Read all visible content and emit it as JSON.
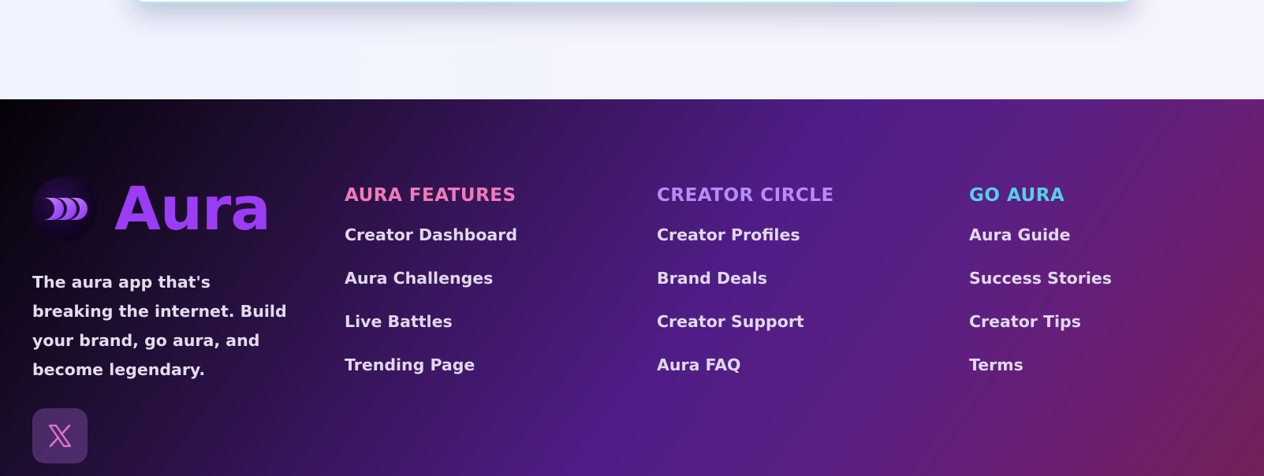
{
  "brand": {
    "name": "Aura",
    "tagline": "The aura app that's breaking the internet. Build your brand, go aura, and become legendary.",
    "accent_color": "#9a3df5",
    "logo_icon": "aura-logo-icon",
    "social": {
      "icon": "x-icon",
      "color": "#e26fd0"
    }
  },
  "columns": [
    {
      "heading": "AURA FEATURES",
      "color": "#f07bb8",
      "links": [
        "Creator Dashboard",
        "Aura Challenges",
        "Live Battles",
        "Trending Page"
      ]
    },
    {
      "heading": "CREATOR CIRCLE",
      "color": "#b88cf7",
      "links": [
        "Creator Profiles",
        "Brand Deals",
        "Creator Support",
        "Aura FAQ"
      ]
    },
    {
      "heading": "GO AURA",
      "color": "#57cfe6",
      "links": [
        "Aura Guide",
        "Success Stories",
        "Creator Tips",
        "Terms"
      ]
    }
  ]
}
